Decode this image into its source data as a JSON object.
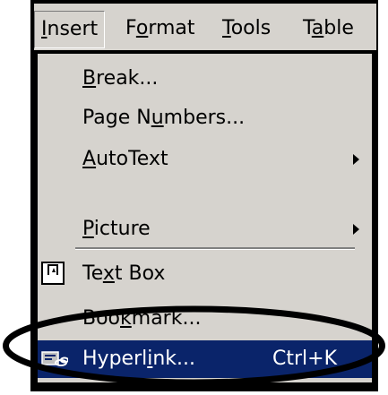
{
  "menubar": {
    "items": [
      {
        "prefix": "",
        "underline": "I",
        "suffix": "nsert"
      },
      {
        "prefix": "F",
        "underline": "o",
        "suffix": "rmat"
      },
      {
        "prefix": "",
        "underline": "T",
        "suffix": "ools"
      },
      {
        "prefix": "T",
        "underline": "a",
        "suffix": "ble"
      }
    ]
  },
  "menu": {
    "items": [
      {
        "prefix": "",
        "underline": "B",
        "suffix": "reak..."
      },
      {
        "prefix": "Page N",
        "underline": "u",
        "suffix": "mbers..."
      },
      {
        "prefix": "",
        "underline": "A",
        "suffix": "utoText"
      },
      {
        "prefix": "",
        "underline": "P",
        "suffix": "icture"
      },
      {
        "prefix": "Te",
        "underline": "x",
        "suffix": "t Box"
      },
      {
        "prefix": "Boo",
        "underline": "k",
        "suffix": "mark..."
      },
      {
        "prefix": "Hyperl",
        "underline": "i",
        "suffix": "nk...",
        "shortcut": "Ctrl+K"
      }
    ]
  },
  "colors": {
    "menu_bg": "#d6d3ce",
    "highlight_bg": "#0a246a",
    "highlight_fg": "#ffffff",
    "annotation": "#000000"
  },
  "icons": [
    "submenu-arrow-icon",
    "text-box-icon",
    "hyperlink-icon"
  ]
}
